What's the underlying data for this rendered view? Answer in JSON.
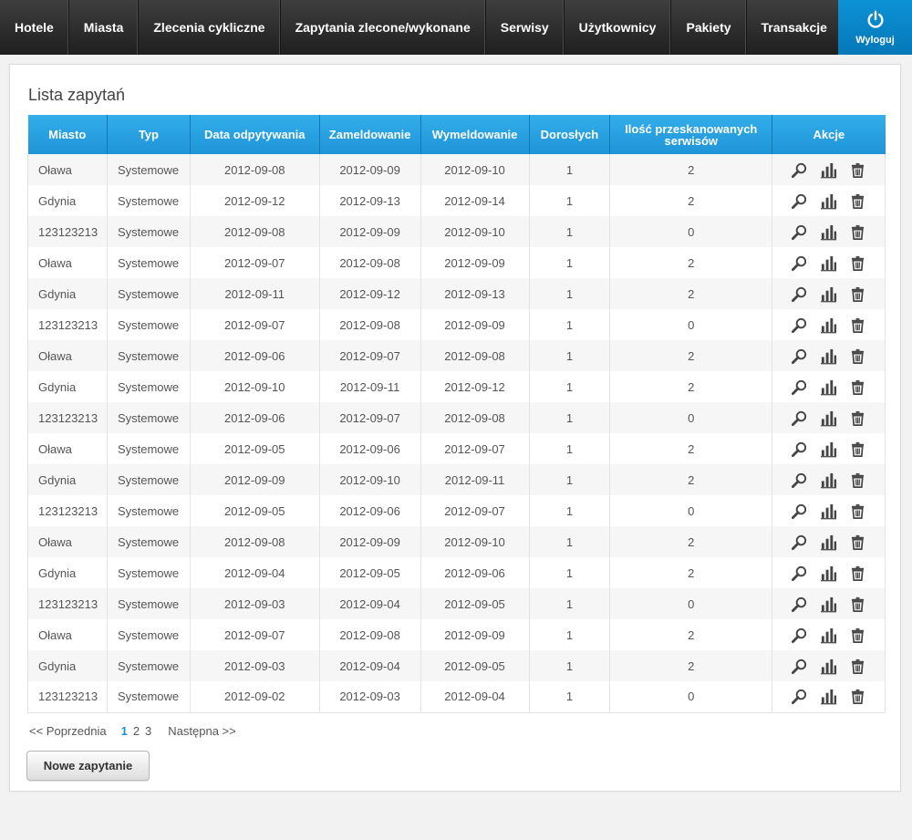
{
  "nav": {
    "items": [
      "Hotele",
      "Miasta",
      "Zlecenia cykliczne",
      "Zapytania zlecone/wykonane",
      "Serwisy",
      "Użytkownicy",
      "Pakiety",
      "Transakcje"
    ],
    "logout_label": "Wyloguj"
  },
  "page_title": "Lista zapytań",
  "table": {
    "headers": [
      "Miasto",
      "Typ",
      "Data odpytywania",
      "Zameldowanie",
      "Wymeldowanie",
      "Dorosłych",
      "Ilość przeskanowanych serwisów",
      "Akcje"
    ],
    "rows": [
      [
        "Oława",
        "Systemowe",
        "2012-09-08",
        "2012-09-09",
        "2012-09-10",
        "1",
        "2"
      ],
      [
        "Gdynia",
        "Systemowe",
        "2012-09-12",
        "2012-09-13",
        "2012-09-14",
        "1",
        "2"
      ],
      [
        "123123213",
        "Systemowe",
        "2012-09-08",
        "2012-09-09",
        "2012-09-10",
        "1",
        "0"
      ],
      [
        "Oława",
        "Systemowe",
        "2012-09-07",
        "2012-09-08",
        "2012-09-09",
        "1",
        "2"
      ],
      [
        "Gdynia",
        "Systemowe",
        "2012-09-11",
        "2012-09-12",
        "2012-09-13",
        "1",
        "2"
      ],
      [
        "123123213",
        "Systemowe",
        "2012-09-07",
        "2012-09-08",
        "2012-09-09",
        "1",
        "0"
      ],
      [
        "Oława",
        "Systemowe",
        "2012-09-06",
        "2012-09-07",
        "2012-09-08",
        "1",
        "2"
      ],
      [
        "Gdynia",
        "Systemowe",
        "2012-09-10",
        "2012-09-11",
        "2012-09-12",
        "1",
        "2"
      ],
      [
        "123123213",
        "Systemowe",
        "2012-09-06",
        "2012-09-07",
        "2012-09-08",
        "1",
        "0"
      ],
      [
        "Oława",
        "Systemowe",
        "2012-09-05",
        "2012-09-06",
        "2012-09-07",
        "1",
        "2"
      ],
      [
        "Gdynia",
        "Systemowe",
        "2012-09-09",
        "2012-09-10",
        "2012-09-11",
        "1",
        "2"
      ],
      [
        "123123213",
        "Systemowe",
        "2012-09-05",
        "2012-09-06",
        "2012-09-07",
        "1",
        "0"
      ],
      [
        "Oława",
        "Systemowe",
        "2012-09-08",
        "2012-09-09",
        "2012-09-10",
        "1",
        "2"
      ],
      [
        "Gdynia",
        "Systemowe",
        "2012-09-04",
        "2012-09-05",
        "2012-09-06",
        "1",
        "2"
      ],
      [
        "123123213",
        "Systemowe",
        "2012-09-03",
        "2012-09-04",
        "2012-09-05",
        "1",
        "0"
      ],
      [
        "Oława",
        "Systemowe",
        "2012-09-07",
        "2012-09-08",
        "2012-09-09",
        "1",
        "2"
      ],
      [
        "Gdynia",
        "Systemowe",
        "2012-09-03",
        "2012-09-04",
        "2012-09-05",
        "1",
        "2"
      ],
      [
        "123123213",
        "Systemowe",
        "2012-09-02",
        "2012-09-03",
        "2012-09-04",
        "1",
        "0"
      ]
    ],
    "row_actions": [
      "magnifier-icon",
      "bar-chart-icon",
      "trash-icon"
    ]
  },
  "pagination": {
    "prev_label": "<< Poprzednia",
    "pages": [
      "1",
      "2",
      "3"
    ],
    "current": "1",
    "next_label": "Następna >>"
  },
  "new_query_label": "Nowe zapytanie",
  "colors": {
    "nav_bg": "#2b2b2b",
    "accent": "#1f94d8",
    "logout_bg": "#0a87c9"
  }
}
